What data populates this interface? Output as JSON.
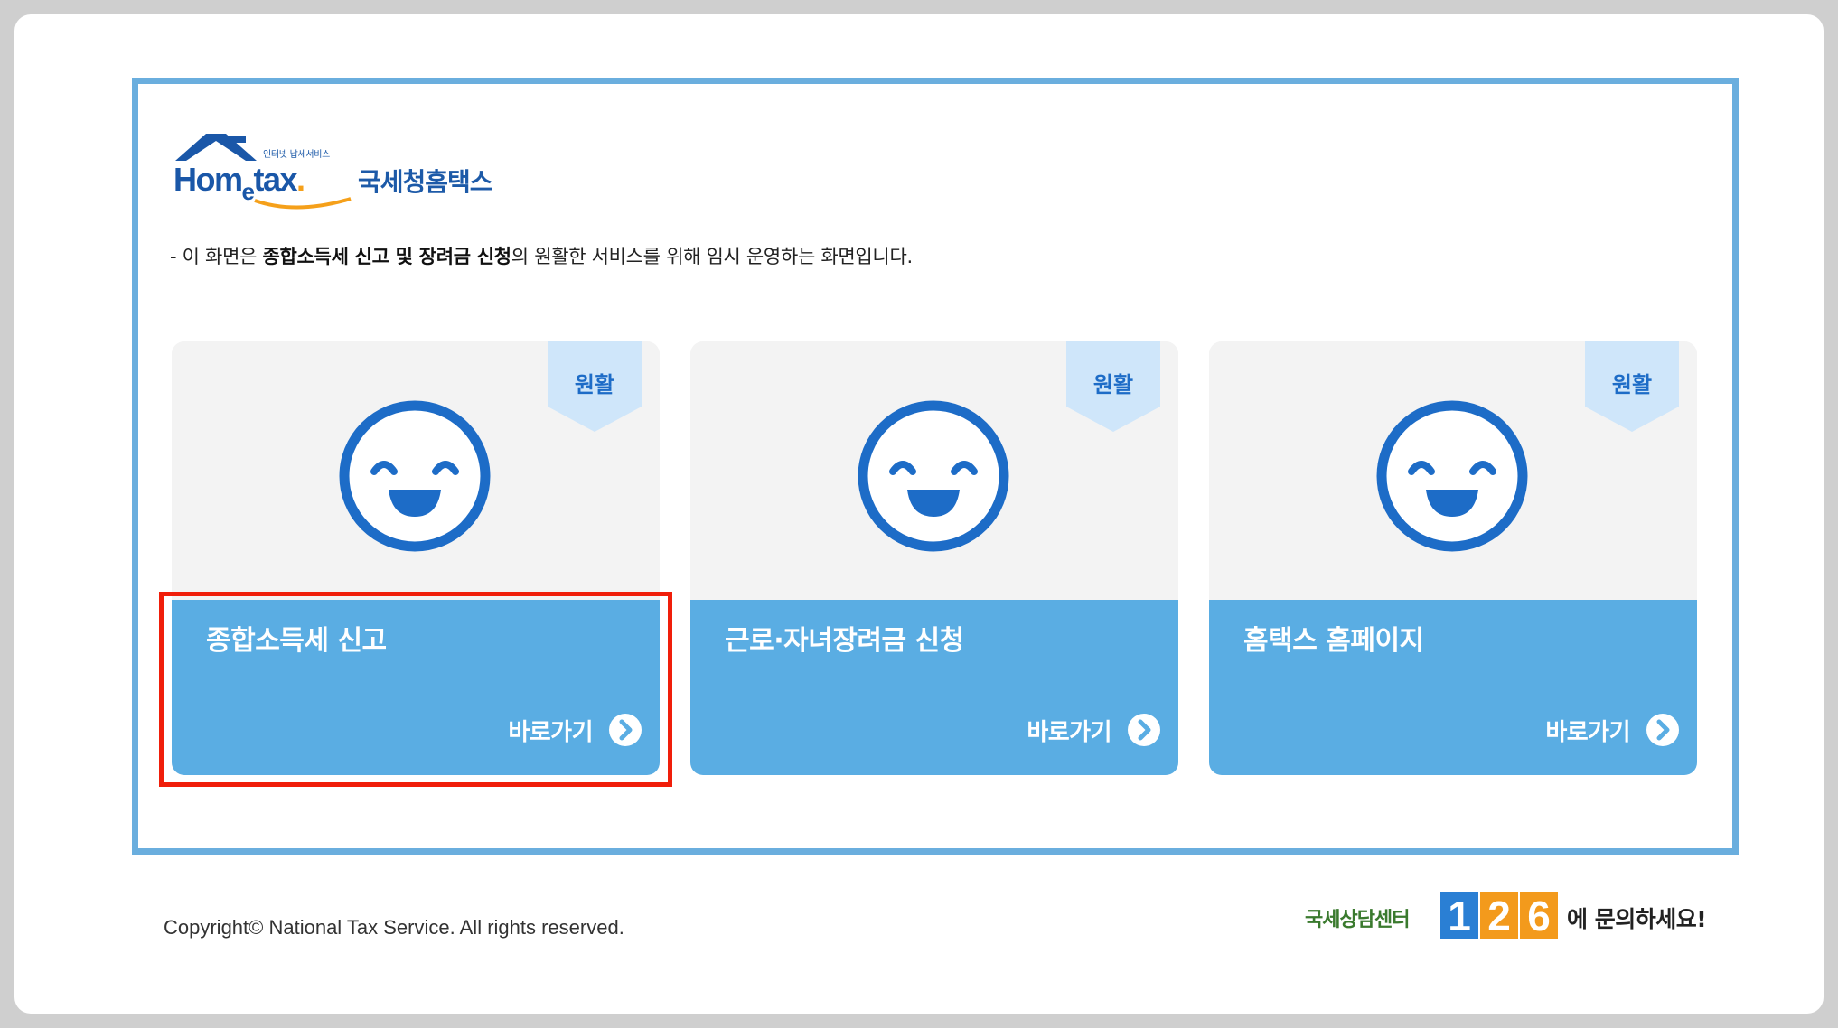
{
  "logo": {
    "small_text": "인터넷 납세서비스",
    "word_main": "Hom",
    "word_e": "e",
    "word_rest": "tax",
    "word_dot": ".",
    "korean": "국세청홈택스"
  },
  "notice": {
    "prefix": "- 이 화면은 ",
    "bold": "종합소득세 신고 및 장려금 신청",
    "suffix": "의 원활한 서비스를 위해 임시 운영하는 화면입니다."
  },
  "cards": [
    {
      "status": "원활",
      "title": "종합소득세 신고",
      "link": "바로가기"
    },
    {
      "status": "원활",
      "title": "근로·자녀장려금 신청",
      "link": "바로가기"
    },
    {
      "status": "원활",
      "title": "홈택스 홈페이지",
      "link": "바로가기"
    }
  ],
  "footer": {
    "copyright": "Copyright© National Tax Service. All rights reserved.",
    "center_label": "국세상담센터",
    "center_digits": [
      "1",
      "2",
      "6"
    ],
    "center_suffix": "에 문의하세요!"
  },
  "colors": {
    "frame": "#6aaede",
    "card_bottom": "#5aade3",
    "face": "#1d6cc7",
    "badge": "#cfe6fa",
    "highlight": "#f01e0a",
    "digit_colors": [
      "#2a7fd4",
      "#f39a1c",
      "#f39a1c"
    ]
  },
  "icons": {
    "face": "smiley-face-icon",
    "go": "chevron-right-circle-icon",
    "logo": "house-roof-icon"
  }
}
